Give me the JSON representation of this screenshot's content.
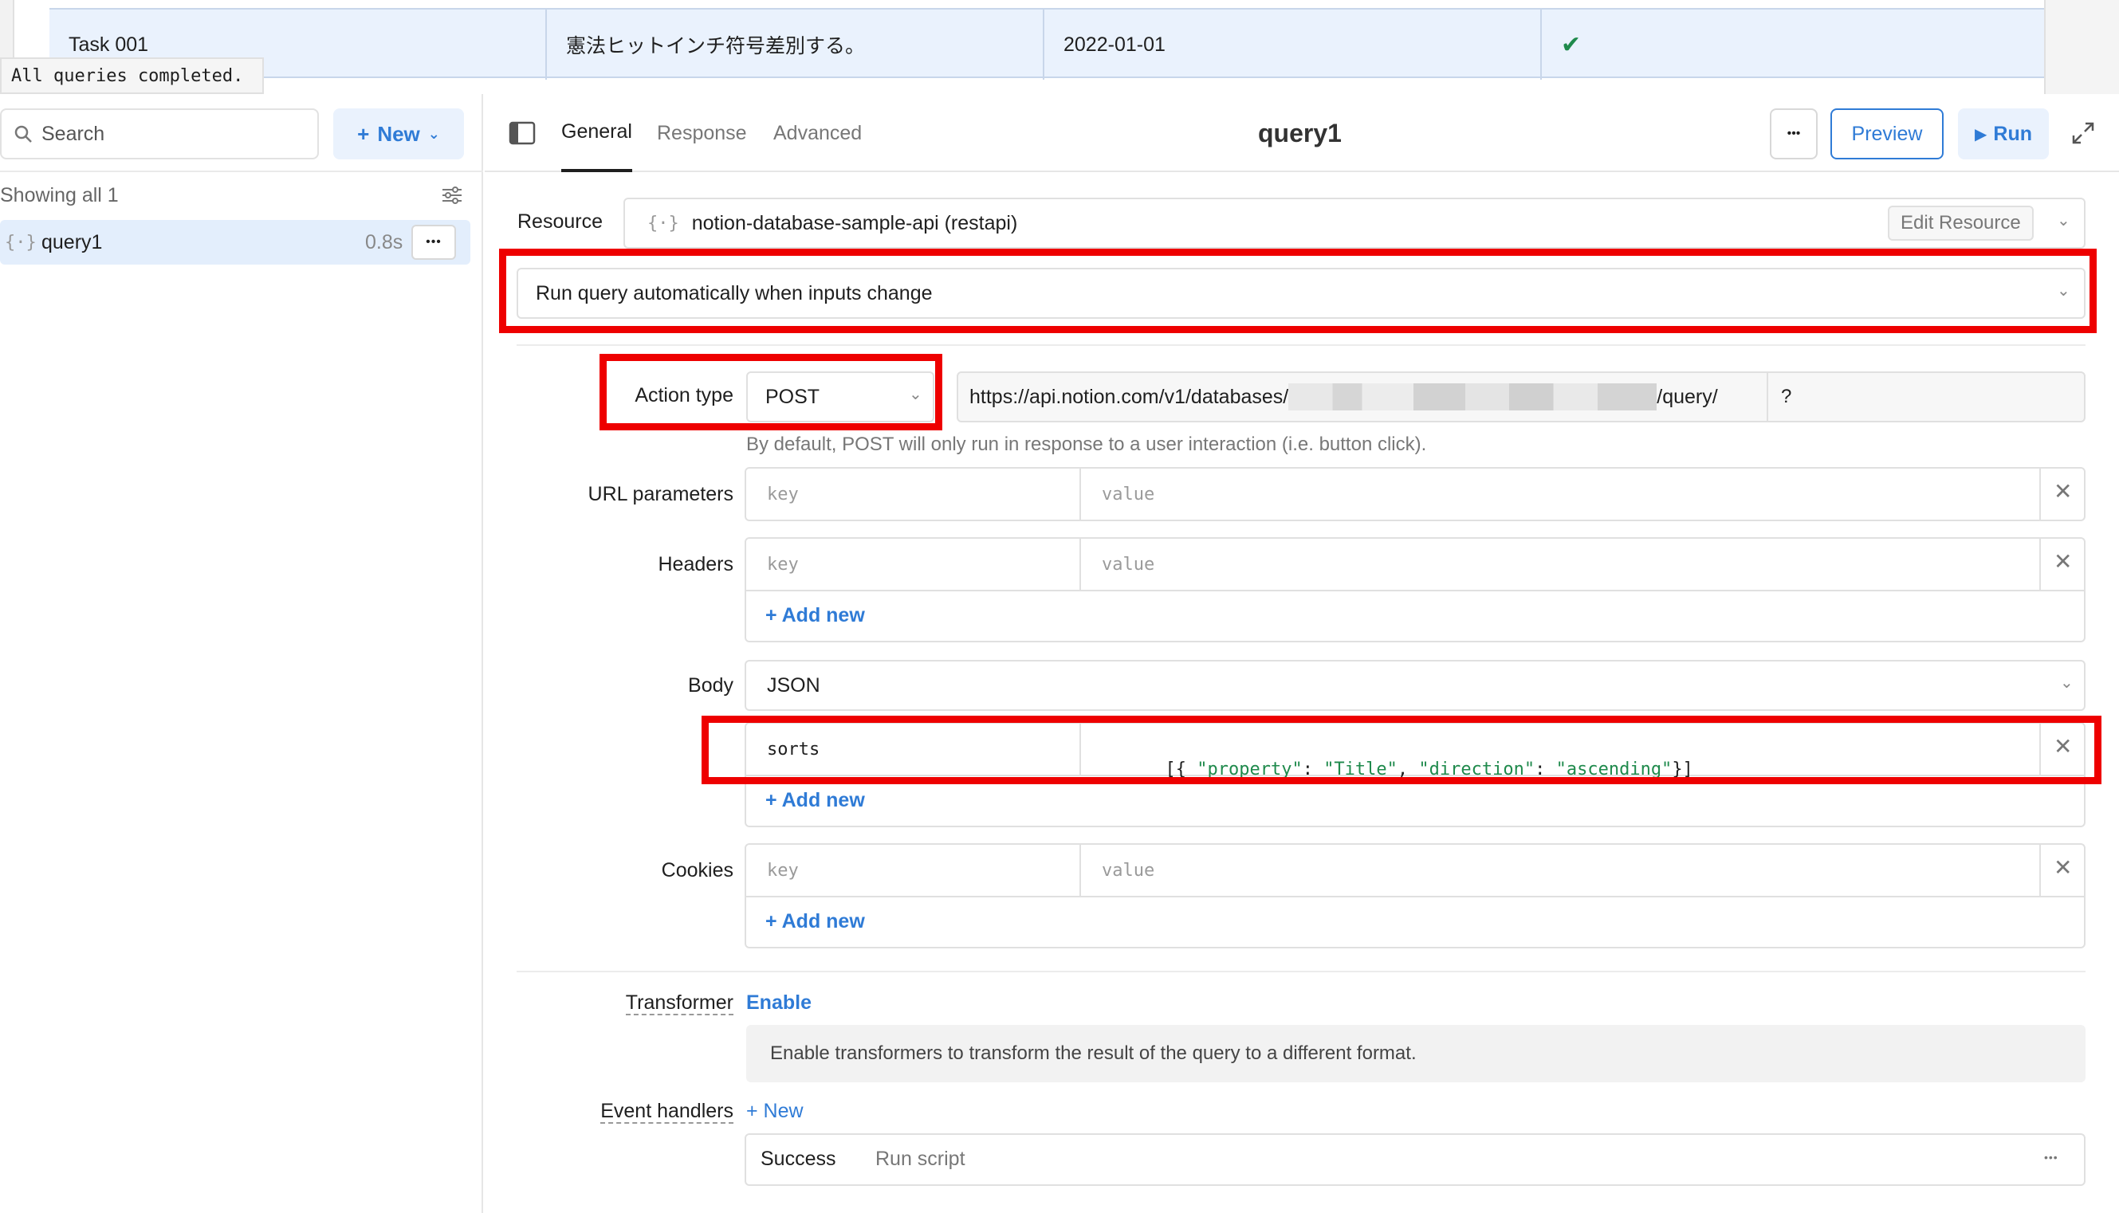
{
  "table": {
    "row": {
      "task": "Task 001",
      "description": "憲法ヒットインチ符号差別する。",
      "date": "2022-01-01",
      "done": "✔"
    }
  },
  "toast": "All queries completed.",
  "left_panel": {
    "search_placeholder": "Search",
    "new_button": "New",
    "showing": "Showing all 1",
    "query": {
      "name": "query1",
      "time": "0.8s",
      "more": "•••"
    }
  },
  "header": {
    "tabs": [
      "General",
      "Response",
      "Advanced"
    ],
    "title": "query1",
    "more": "•••",
    "preview": "Preview",
    "run": "Run"
  },
  "resource": {
    "label": "Resource",
    "value": "notion-database-sample-api (restapi)",
    "edit": "Edit Resource"
  },
  "trigger": {
    "value": "Run query automatically when inputs change"
  },
  "action": {
    "label": "Action type",
    "method": "POST",
    "url_prefix": "https://api.notion.com/v1/databases/",
    "url_suffix": "/query/",
    "query_mark": "?",
    "hint": "By default, POST will only run in response to a user interaction (i.e. button click)."
  },
  "url_params": {
    "label": "URL parameters",
    "key": "key",
    "value": "value"
  },
  "headers": {
    "label": "Headers",
    "key": "key",
    "value": "value",
    "add": "+ Add new"
  },
  "body": {
    "label": "Body",
    "type": "JSON",
    "key": "sorts",
    "value_parts": [
      "[{ ",
      "\"property\"",
      ": ",
      "\"Title\"",
      ", ",
      "\"direction\"",
      ": ",
      "\"ascending\"",
      "}]"
    ],
    "add": "+ Add new"
  },
  "cookies": {
    "label": "Cookies",
    "key": "key",
    "value": "value",
    "add": "+ Add new"
  },
  "transformer": {
    "label": "Transformer",
    "enable": "Enable",
    "description": "Enable transformers to transform the result of the query to a different format."
  },
  "event_handlers": {
    "label": "Event handlers",
    "new": "+ New",
    "event": "Success",
    "action": "Run script",
    "more": "•••"
  },
  "colors": {
    "accent": "#2f7bd6",
    "highlight": "#ee0000",
    "selection": "#e3eefc",
    "string": "#1f8a4c"
  }
}
